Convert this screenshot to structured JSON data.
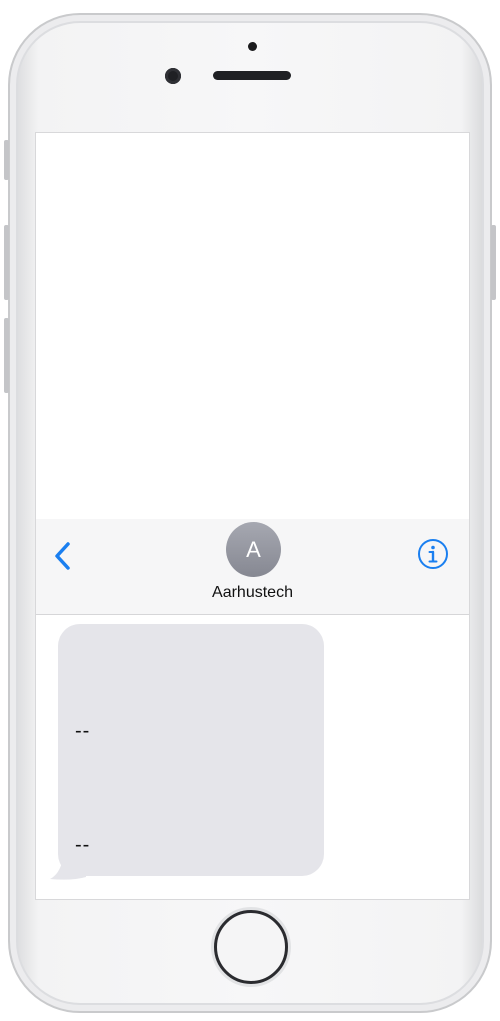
{
  "conversation": {
    "contact_initial": "A",
    "contact_name": "Aarhustech"
  },
  "navigation": {
    "back_icon": "chevron-left-icon",
    "info_icon": "info-circle-icon"
  },
  "messages": [
    {
      "direction": "incoming",
      "lines": [
        "--",
        "--"
      ]
    }
  ],
  "colors": {
    "accent": "#1a7ff0",
    "incoming_bubble": "#e5e5ea",
    "avatar": "#9a9ca5"
  }
}
